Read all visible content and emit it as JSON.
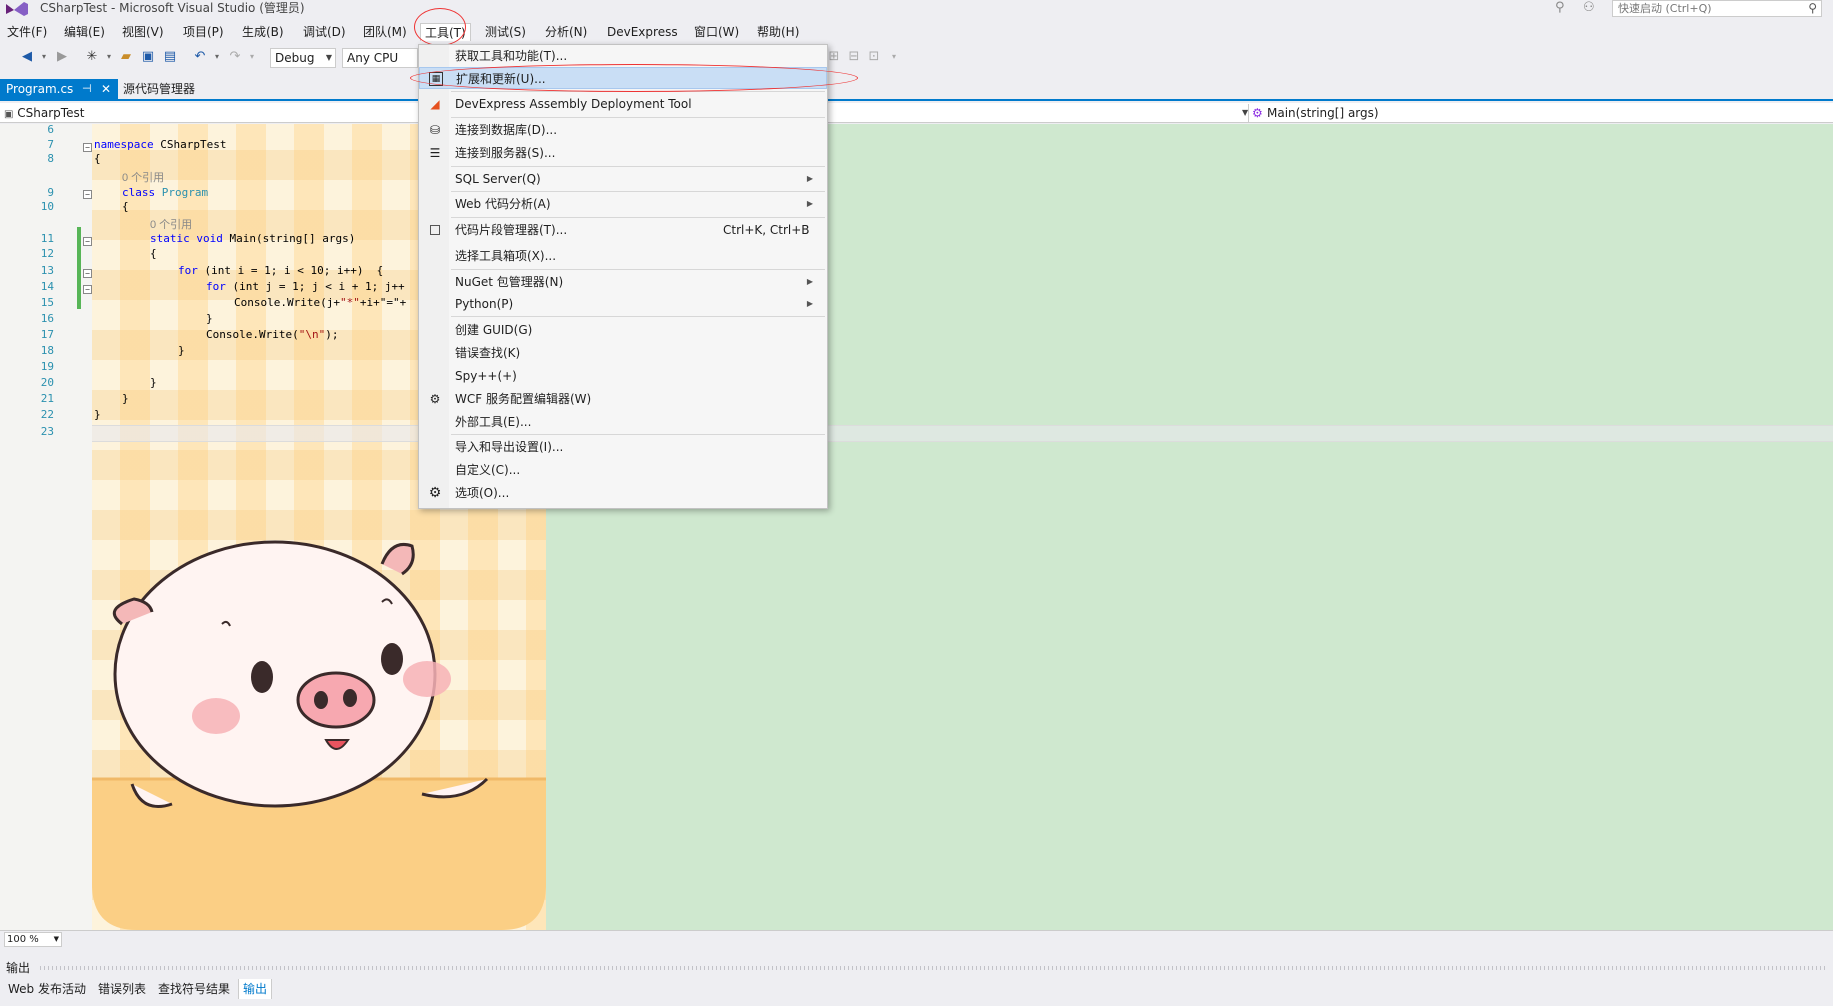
{
  "window": {
    "title": "CSharpTest - Microsoft Visual Studio (管理员)",
    "quick_launch_placeholder": "快速启动 (Ctrl+Q)"
  },
  "menubar": {
    "items": [
      "文件(F)",
      "编辑(E)",
      "视图(V)",
      "项目(P)",
      "生成(B)",
      "调试(D)",
      "团队(M)",
      "工具(T)",
      "测试(S)",
      "分析(N)",
      "DevExpress",
      "窗口(W)",
      "帮助(H)"
    ]
  },
  "toolbar": {
    "config": "Debug",
    "platform": "Any CPU"
  },
  "tabs": {
    "active": "Program.cs",
    "inactive": "源代码管理器"
  },
  "navbar": {
    "project": "CSharpTest",
    "member": "Main(string[] args)"
  },
  "code": {
    "line_numbers": [
      "6",
      "7",
      "8",
      "",
      "9",
      "10",
      "",
      "11",
      "12",
      "13",
      "14",
      "15",
      "16",
      "17",
      "18",
      "19",
      "20",
      "21",
      "22",
      "23"
    ],
    "namespace_kw": "namespace",
    "namespace_name": " CSharpTest",
    "open_brace": "{",
    "close_brace": "}",
    "ref_label": "0 个引用",
    "class_kw": "class",
    "class_name": " Program",
    "static_void_kw": "static void",
    "main_sig": " Main(string[] args)",
    "for1": "for",
    "for1_rest": " (int i = 1; i < 10; i++)  {",
    "for2": "for",
    "for2_rest": " (int j = 1; j < i + 1; j++",
    "write1_pre": "Console.Write(j+",
    "write1_str": "\"*\"",
    "write1_post": "+i+\"=\"+",
    "close_for2": "}",
    "write2_pre": "Console.Write(",
    "write2_str": "\"\\n\"",
    "write2_post": ");"
  },
  "tools_menu": {
    "items": [
      {
        "label": "获取工具和功能(T)..."
      },
      {
        "label": "扩展和更新(U)..."
      },
      {
        "label": "DevExpress Assembly Deployment Tool"
      },
      {
        "label": "连接到数据库(D)..."
      },
      {
        "label": "连接到服务器(S)..."
      },
      {
        "label": "SQL Server(Q)"
      },
      {
        "label": "Web 代码分析(A)"
      },
      {
        "label": "代码片段管理器(T)...",
        "shortcut": "Ctrl+K, Ctrl+B"
      },
      {
        "label": "选择工具箱项(X)..."
      },
      {
        "label": "NuGet 包管理器(N)"
      },
      {
        "label": "Python(P)"
      },
      {
        "label": "创建 GUID(G)"
      },
      {
        "label": "错误查找(K)"
      },
      {
        "label": "Spy++(+)"
      },
      {
        "label": "WCF 服务配置编辑器(W)"
      },
      {
        "label": "外部工具(E)..."
      },
      {
        "label": "导入和导出设置(I)..."
      },
      {
        "label": "自定义(C)..."
      },
      {
        "label": "选项(O)..."
      }
    ]
  },
  "zoom": "100 %",
  "output": {
    "title": "输出",
    "tabs": [
      "Web 发布活动",
      "错误列表",
      "查找符号结果",
      "输出"
    ]
  },
  "colors": {
    "accent": "#007acc",
    "editor_bg": "#cfe8cf",
    "annotation_red": "#e33333"
  }
}
